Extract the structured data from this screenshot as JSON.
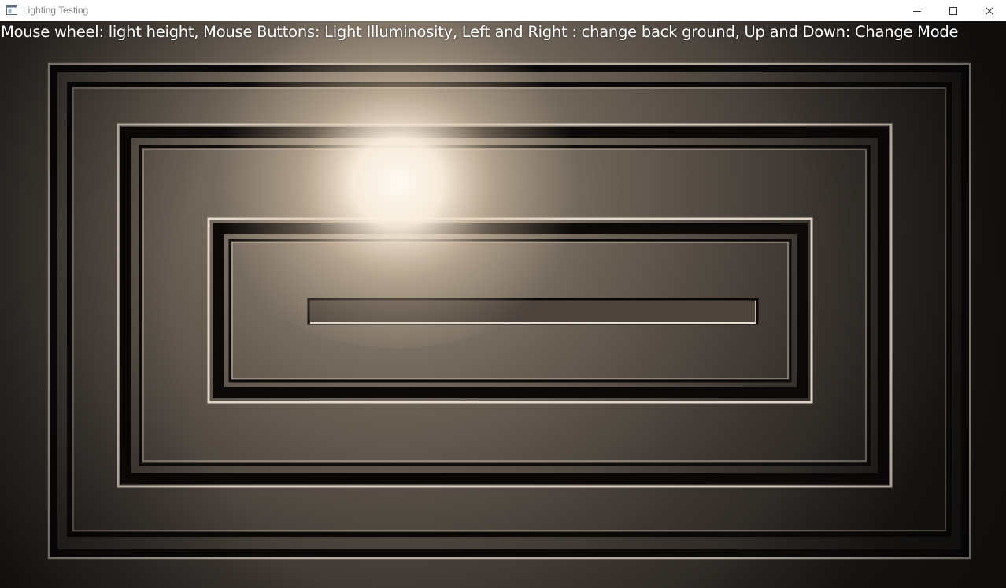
{
  "window": {
    "title": "Lighting Testing",
    "app_icon": "app-window-icon",
    "controls": {
      "minimize_icon": "minimize-icon",
      "maximize_icon": "maximize-icon",
      "close_icon": "close-icon"
    }
  },
  "scene": {
    "help_text": "Mouse wheel: light height, Mouse Buttons: Light Illuminosity, Left and Right : change back ground, Up and Down: Change Mode",
    "colors": {
      "background_dark": "#1e1b18",
      "surface_tone": "#6e6459",
      "light_core": "#fff8ee",
      "light_warm": "#e6d2ba",
      "groove_dark": "#080706",
      "rim_light": "#d9cfc2"
    }
  }
}
